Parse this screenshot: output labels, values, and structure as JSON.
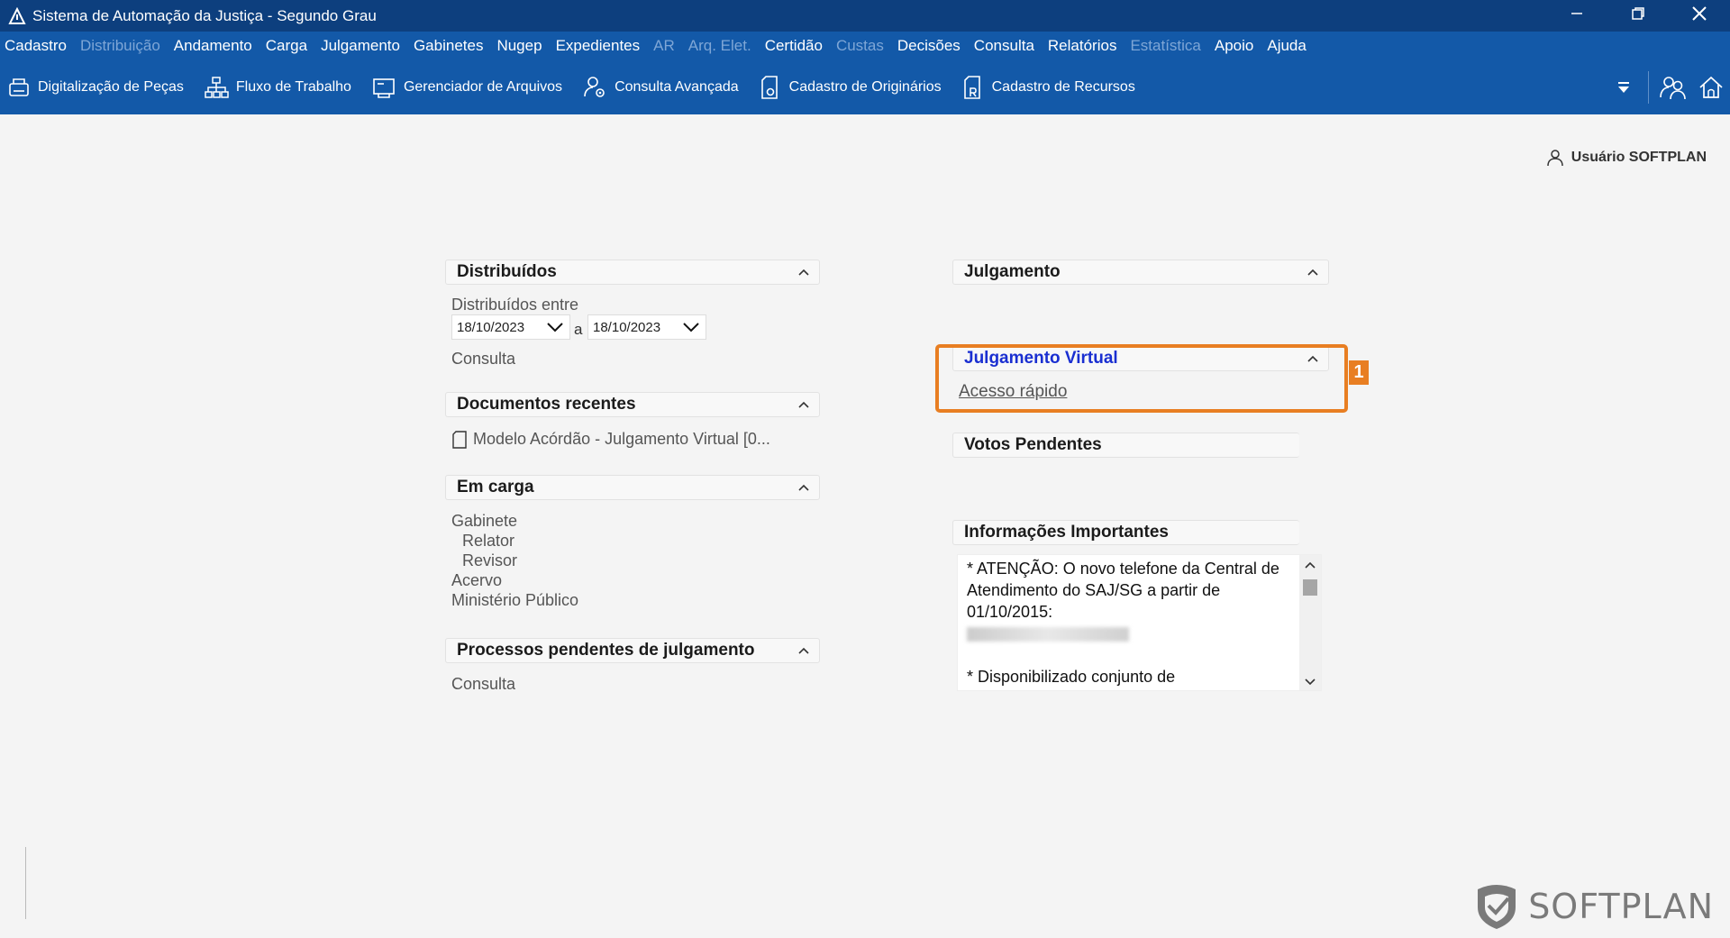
{
  "window": {
    "title": "Sistema de Automação da Justiça - Segundo Grau",
    "controls": [
      "minimize-icon",
      "restore-icon",
      "close-icon"
    ]
  },
  "menu": [
    {
      "label": "Cadastro",
      "enabled": true
    },
    {
      "label": "Distribuição",
      "enabled": false
    },
    {
      "label": "Andamento",
      "enabled": true
    },
    {
      "label": "Carga",
      "enabled": true
    },
    {
      "label": "Julgamento",
      "enabled": true
    },
    {
      "label": "Gabinetes",
      "enabled": true
    },
    {
      "label": "Nugep",
      "enabled": true
    },
    {
      "label": "Expedientes",
      "enabled": true
    },
    {
      "label": "AR",
      "enabled": false
    },
    {
      "label": "Arq. Elet.",
      "enabled": false
    },
    {
      "label": "Certidão",
      "enabled": true
    },
    {
      "label": "Custas",
      "enabled": false
    },
    {
      "label": "Decisões",
      "enabled": true
    },
    {
      "label": "Consulta",
      "enabled": true
    },
    {
      "label": "Relatórios",
      "enabled": true
    },
    {
      "label": "Estatística",
      "enabled": false
    },
    {
      "label": "Apoio",
      "enabled": true
    },
    {
      "label": "Ajuda",
      "enabled": true
    }
  ],
  "toolbar": {
    "items": [
      {
        "label": "Digitalização de Peças",
        "icon": "scanner-icon"
      },
      {
        "label": "Fluxo de Trabalho",
        "icon": "workflow-icon"
      },
      {
        "label": "Gerenciador de Arquivos",
        "icon": "file-manager-icon"
      },
      {
        "label": "Consulta Avançada",
        "icon": "advanced-search-icon"
      },
      {
        "label": "Cadastro de Originários",
        "icon": "document-o-icon"
      },
      {
        "label": "Cadastro de Recursos",
        "icon": "document-r-icon"
      }
    ]
  },
  "user": {
    "label": "Usuário SOFTPLAN"
  },
  "left": {
    "distribuidos": {
      "title": "Distribuídos",
      "range_label": "Distribuídos entre",
      "date_from": "18/10/2023",
      "separator": "a",
      "date_to": "18/10/2023",
      "consulta": "Consulta"
    },
    "documentos": {
      "title": "Documentos recentes",
      "item": "Modelo Acórdão - Julgamento Virtual [0..."
    },
    "em_carga": {
      "title": "Em carga",
      "items": [
        "Gabinete",
        "Relator",
        "Revisor",
        "Acervo",
        "Ministério Público"
      ]
    },
    "pendentes": {
      "title": "Processos pendentes de julgamento",
      "consulta": "Consulta"
    }
  },
  "right": {
    "julgamento": {
      "title": "Julgamento"
    },
    "julgamento_virtual": {
      "title": "Julgamento Virtual",
      "link": "Acesso rápido"
    },
    "votos": {
      "title": "Votos Pendentes"
    },
    "info": {
      "title": "Informações Importantes",
      "line1": "* ATENÇÃO: O novo telefone da Central de Atendimento do SAJ/SG a partir de 01/10/2015:",
      "line2": "* Disponibilizado conjunto de"
    }
  },
  "annotation": {
    "badge": "1",
    "color": "#e87e22"
  },
  "brand": {
    "logo_text": "SOFTPLAN"
  },
  "colors": {
    "title_bar": "#0d3f7e",
    "menu_bar": "#1359a8",
    "link_blue": "#1a2fd1"
  }
}
